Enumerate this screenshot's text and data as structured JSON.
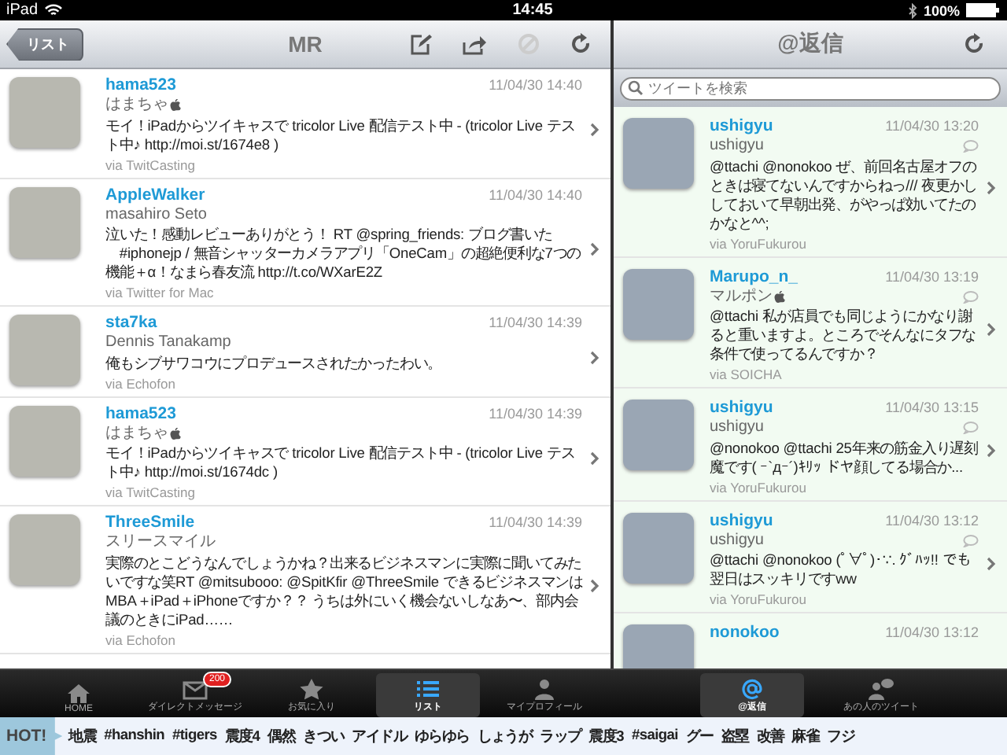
{
  "status_bar": {
    "device": "iPad",
    "time": "14:45",
    "battery": "100%"
  },
  "left_pane": {
    "back_button": "リスト",
    "title": "MR",
    "tweets": [
      {
        "user": "hama523",
        "name": "はまちゃ",
        "apple": true,
        "time": "11/04/30 14:40",
        "text": "モイ！iPadからツイキャスで tricolor Live 配信テスト中 - (tricolor Live テスト中♪ http://moi.st/1674e8 )",
        "via": "via TwitCasting"
      },
      {
        "user": "AppleWalker",
        "name": "masahiro Seto",
        "apple": false,
        "time": "11/04/30 14:40",
        "text": "泣いた！感動レビューありがとう！ RT @spring_friends: ブログ書いた 　#iphonejp / 無音シャッターカメラアプリ「OneCam」の超絶便利な7つの機能＋α！なまら春友流 http://t.co/WXarE2Z",
        "via": "via Twitter for Mac"
      },
      {
        "user": "sta7ka",
        "name": "Dennis Tanakamp",
        "apple": false,
        "time": "11/04/30 14:39",
        "text": "俺もシブサワコウにプロデュースされたかったわい。",
        "via": "via Echofon"
      },
      {
        "user": "hama523",
        "name": "はまちゃ",
        "apple": true,
        "time": "11/04/30 14:39",
        "text": "モイ！iPadからツイキャスで tricolor Live 配信テスト中 - (tricolor Live テスト中♪ http://moi.st/1674dc )",
        "via": "via TwitCasting"
      },
      {
        "user": "ThreeSmile",
        "name": "スリースマイル",
        "apple": false,
        "time": "11/04/30 14:39",
        "text": "実際のとこどうなんでしょうかね？出来るビジネスマンに実際に聞いてみたいですな笑RT @mitsubooo: @SpitKfir @ThreeSmile できるビジネスマンはMBA＋iPad＋iPhoneですか？？ うちは外にいく機会ないしなあ〜、部内会議のときにiPad……",
        "via": "via Echofon"
      }
    ]
  },
  "right_pane": {
    "title": "@返信",
    "search": {
      "placeholder": "ツイートを検索"
    },
    "tweets": [
      {
        "user": "ushigyu",
        "name": "ushigyu",
        "apple": false,
        "time": "11/04/30 13:20",
        "text": "@ttachi @nonokoo ぜ、前回名古屋オフのときは寝てないんですからねっ/// 夜更かししておいて早朝出発、がやっぱ効いてたのかなと^^;",
        "via": "via YoruFukurou"
      },
      {
        "user": "Marupo_n_",
        "name": "マルポン",
        "apple": true,
        "time": "11/04/30 13:19",
        "text": "@ttachi 私が店員でも同じようにかなり謝ると重いますよ。ところでそんなにタフな条件で使ってるんですか？",
        "via": "via SOICHA"
      },
      {
        "user": "ushigyu",
        "name": "ushigyu",
        "apple": false,
        "time": "11/04/30 13:15",
        "text": "@nonokoo @ttachi 25年来の筋金入り遅刻魔です( ｰ`дｰ´)ｷﾘｯ ドヤ顔してる場合か...",
        "via": "via YoruFukurou"
      },
      {
        "user": "ushigyu",
        "name": "ushigyu",
        "apple": false,
        "time": "11/04/30 13:12",
        "text": "@ttachi @nonokoo (ﾟ∀ﾟ)･∵. ｸﾞﾊｯ!! でも翌日はスッキリですww",
        "via": "via YoruFukurou"
      },
      {
        "user": "nonokoo",
        "time": "11/04/30 13:12"
      }
    ]
  },
  "tab_bar": {
    "left_tabs": [
      {
        "label": "HOME",
        "selected": false
      },
      {
        "label": "ダイレクトメッセージ",
        "badge": "200",
        "selected": false
      },
      {
        "label": "お気に入り",
        "selected": false
      },
      {
        "label": "リスト",
        "selected": true
      },
      {
        "label": "マイプロフィール",
        "selected": false
      }
    ],
    "right_tabs": [
      {
        "label": "@返信",
        "selected": true
      },
      {
        "label": "あの人のツイート",
        "selected": false
      }
    ]
  },
  "hot_bar": {
    "label": "HOT!",
    "tags": [
      "地震",
      "#hanshin",
      "#tigers",
      "震度4",
      "偶然",
      "きつい",
      "アイドル",
      "ゆらゆら",
      "しょうが",
      "ラップ",
      "震度3",
      "#saigai",
      "グー",
      "盗塁",
      "改善",
      "麻雀",
      "フジ"
    ]
  }
}
